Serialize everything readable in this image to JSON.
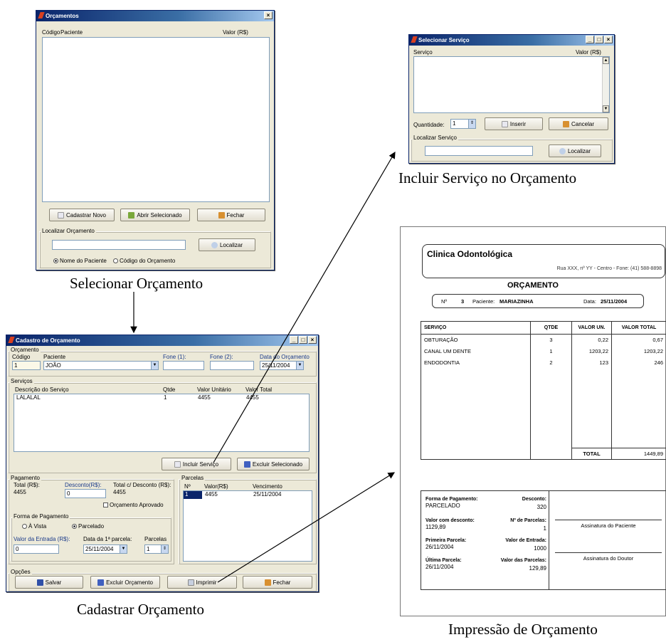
{
  "orcamentos": {
    "title": "Orçamentos",
    "col_code": "Código",
    "col_patient": "Paciente",
    "col_value": "Valor (R$)",
    "btn_new": "Cadastrar Novo",
    "btn_open": "Abrir Selecionado",
    "btn_close": "Fechar",
    "find_group": "Localizar Orçamento",
    "btn_find": "Localizar",
    "radio_name": "Nome do Paciente",
    "radio_code": "Código do Orçamento",
    "caption": "Selecionar Orçamento"
  },
  "servico": {
    "title": "Selecionar Serviço",
    "col_service": "Serviço",
    "col_value": "Valor (R$)",
    "qty_label": "Quantidade:",
    "qty_value": "1",
    "btn_insert": "Inserir",
    "btn_cancel": "Cancelar",
    "find_group": "Localizar Serviço",
    "btn_find": "Localizar",
    "caption": "Incluir Serviço no Orçamento"
  },
  "cadastro": {
    "title": "Cadastro de Orçamento",
    "grp_orc": "Orçamento",
    "lbl_code": "Código",
    "code": "1",
    "lbl_patient": "Paciente",
    "patient": "JOÃO",
    "lbl_fone1": "Fone (1):",
    "lbl_fone2": "Fone (2):",
    "lbl_date": "Data do Orçamento",
    "date": "25/11/2004",
    "grp_services": "Serviços",
    "col_desc": "Descrição do Serviço",
    "col_qty": "Qtde",
    "col_unit": "Valor Unitário",
    "col_total": "Valor Total",
    "row": {
      "desc": "LALALAL",
      "qty": "1",
      "unit": "4455",
      "total": "4455"
    },
    "btn_include": "Incluir Serviço",
    "btn_remove": "Excluir Selecionado",
    "grp_payment": "Pagamento",
    "lbl_total": "Total (R$):",
    "total": "4455",
    "lbl_discount": "Desconto(R$):",
    "discount": "0",
    "lbl_total_disc": "Total c/ Desconto (R$):",
    "total_disc": "4455",
    "chk_approved": "Orçamento Aprovado",
    "grp_form": "Forma de Pagamento",
    "radio_cash": "À Vista",
    "radio_install": "Parcelado",
    "lbl_entry": "Valor da Entrada (R$):",
    "entry": "0",
    "lbl_first": "Data da 1ª parcela:",
    "first": "25/11/2004",
    "lbl_parcels": "Parcelas",
    "parcels": "1",
    "grp_parcelas": "Parcelas",
    "p_col_n": "Nº",
    "p_col_value": "Valor(R$)",
    "p_col_due": "Vencimento",
    "p_row": {
      "n": "1",
      "value": "4455",
      "due": "25/11/2004"
    },
    "grp_options": "Opções",
    "btn_save": "Salvar",
    "btn_delete": "Excluir Orçamento",
    "btn_print": "Imprimir",
    "btn_close": "Fechar",
    "caption": "Cadastrar Orçamento"
  },
  "report": {
    "clinic": "Clinica Odontológica",
    "address": "Rua XXX, nº YY - Centro - Fone: (41) 588-8898",
    "title": "ORÇAMENTO",
    "n_label": "Nº",
    "n_value": "3",
    "patient_label": "Paciente:",
    "patient": "MARIAZINHA",
    "date_label": "Data:",
    "date": "25/11/2004",
    "headers": [
      "SERVIÇO",
      "QTDE",
      "VALOR UN.",
      "VALOR TOTAL"
    ],
    "rows": [
      {
        "service": "OBTURAÇÃO",
        "qty": "3",
        "unit": "0,22",
        "total": "0,67"
      },
      {
        "service": "CANAL UM DENTE",
        "qty": "1",
        "unit": "1203,22",
        "total": "1203,22"
      },
      {
        "service": "ENDODONTIA",
        "qty": "2",
        "unit": "123",
        "total": "246"
      }
    ],
    "total_label": "TOTAL",
    "total": "1449,89",
    "pay_form_label": "Forma de Pagamento:",
    "pay_form": "PARCELADO",
    "discount_label": "Desconto:",
    "discount": "320",
    "with_disc_label": "Valor com desconto:",
    "with_disc": "1129,89",
    "n_parcels_label": "Nº de Parcelas:",
    "n_parcels": "1",
    "first_label": "Primeira Parcela:",
    "first": "26/11/2004",
    "entry_label": "Valor de Entrada:",
    "entry": "1000",
    "last_label": "Última Parcela:",
    "last": "26/11/2004",
    "parcel_value_label": "Valor das Parcelas:",
    "parcel_value": "129,89",
    "sig_patient": "Assinatura do Paciente",
    "sig_doctor": "Assinatura do Doutor",
    "caption": "Impressão de Orçamento"
  },
  "colors": {
    "title_bar": "#0a246a",
    "window_bg": "#ece9d8",
    "selection": "#0a246a"
  },
  "icons": [
    "pencil-icon",
    "add-icon",
    "open-icon",
    "exit-icon",
    "search-icon",
    "save-icon",
    "delete-icon",
    "print-icon"
  ]
}
